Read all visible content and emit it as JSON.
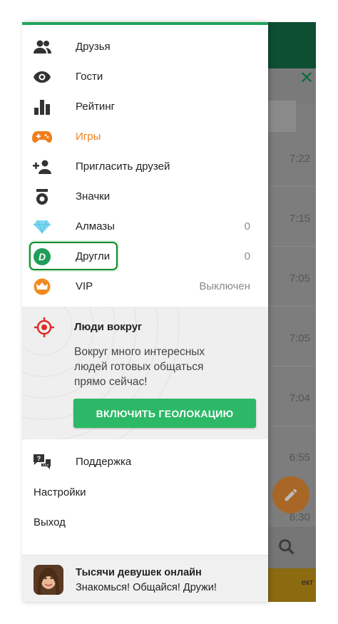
{
  "menu": {
    "items": [
      {
        "label": "Друзья",
        "icon": "friends-icon",
        "value": ""
      },
      {
        "label": "Гости",
        "icon": "eye-icon",
        "value": ""
      },
      {
        "label": "Рейтинг",
        "icon": "bar-chart-icon",
        "value": ""
      },
      {
        "label": "Игры",
        "icon": "gamepad-icon",
        "value": "",
        "color": "#f07f1b"
      },
      {
        "label": "Пригласить друзей",
        "icon": "add-person-icon",
        "value": ""
      },
      {
        "label": "Значки",
        "icon": "badge-icon",
        "value": ""
      },
      {
        "label": "Алмазы",
        "icon": "diamond-icon",
        "value": "0"
      },
      {
        "label": "Другли",
        "icon": "drugli-coin-icon",
        "value": "0"
      },
      {
        "label": "VIP",
        "icon": "vip-crown-icon",
        "value": "Выключен"
      }
    ]
  },
  "people_around": {
    "title": "Люди вокруг",
    "text": "Вокруг много интересных людей готовых общаться прямо сейчас!",
    "button": "ВКЛЮЧИТЬ ГЕОЛОКАЦИЮ"
  },
  "footer_menu": {
    "support": "Поддержка",
    "settings": "Настройки",
    "logout": "Выход"
  },
  "promo": {
    "title": "Тысячи девушек онлайн",
    "subtitle": "Знакомься! Общайся! Дружи!"
  },
  "background": {
    "times": [
      "7:22",
      "7:15",
      "7:05",
      "7:05",
      "7:04",
      "6:55",
      "6:30"
    ],
    "ad_text": "ект"
  },
  "colors": {
    "accent_green": "#2cb866",
    "games_orange": "#f07f1b",
    "appbar_green": "#0d4f33"
  }
}
